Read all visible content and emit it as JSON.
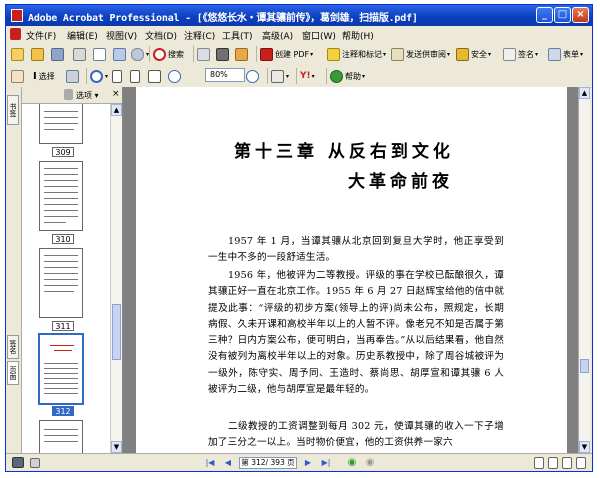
{
  "window": {
    "title": "Adobe Acrobat Professional - [《悠悠长水・谭其骧前传》，葛剑雄，扫描版.pdf]"
  },
  "menu": [
    "文件(F)",
    "编辑(E)",
    "视图(V)",
    "文档(D)",
    "注释(C)",
    "工具(T)",
    "高级(A)",
    "窗口(W)",
    "帮助(H)"
  ],
  "toolbar1": {
    "search": "搜索",
    "create_pdf": "创建 PDF",
    "comment": "注释和标记",
    "send_review": "发送供审阅",
    "secure": "安全",
    "sign": "签名",
    "forms": "表单"
  },
  "toolbar2": {
    "select": "选择",
    "zoom": "80%",
    "help": "帮助"
  },
  "left_tabs": [
    "书签",
    "签名",
    "页面"
  ],
  "panel": {
    "options": "选项",
    "close": "×"
  },
  "thumbnails": [
    {
      "label": "309",
      "selected": false
    },
    {
      "label": "310",
      "selected": false
    },
    {
      "label": "311",
      "selected": false
    },
    {
      "label": "312",
      "selected": true
    }
  ],
  "document": {
    "chapter_line1": "第十三章  从反右到文化",
    "chapter_line2": "大革命前夜",
    "paragraphs": [
      "1957 年 1 月，当谭其骧从北京回到复旦大学时，他正享受到一生中不多的一段舒适生活。",
      "1956 年，他被评为二等教授。评级的事在学校已酝酿很久，谭其骧正好一直在北京工作。1955 年 6 月 27 日赵辉宝给他的信中就提及此事：“评级的初步方案(领导上的评)尚未公布，照规定，长期病假、久未开课和高校半年以上的人暂不评。像老兄不知是否属于第三种？日内方案公布，便可明白，当再奉告。”从以后结果看，他自然没有被列为离校半年以上的对象。历史系教授中，除了周谷城被评为一级外，陈守实、周予同、王造时、蔡尚思、胡厚宣和谭其骧 6 人被评为二级，他与胡厚宣是最年轻的。",
      "二级教授的工资调整到每月 302 元，使谭其骧的收入一下子增加了三分之一以上。当时物价便宜，他的工资供养一家六"
    ]
  },
  "status": {
    "page_indicator": "第 312/ 393 页"
  }
}
